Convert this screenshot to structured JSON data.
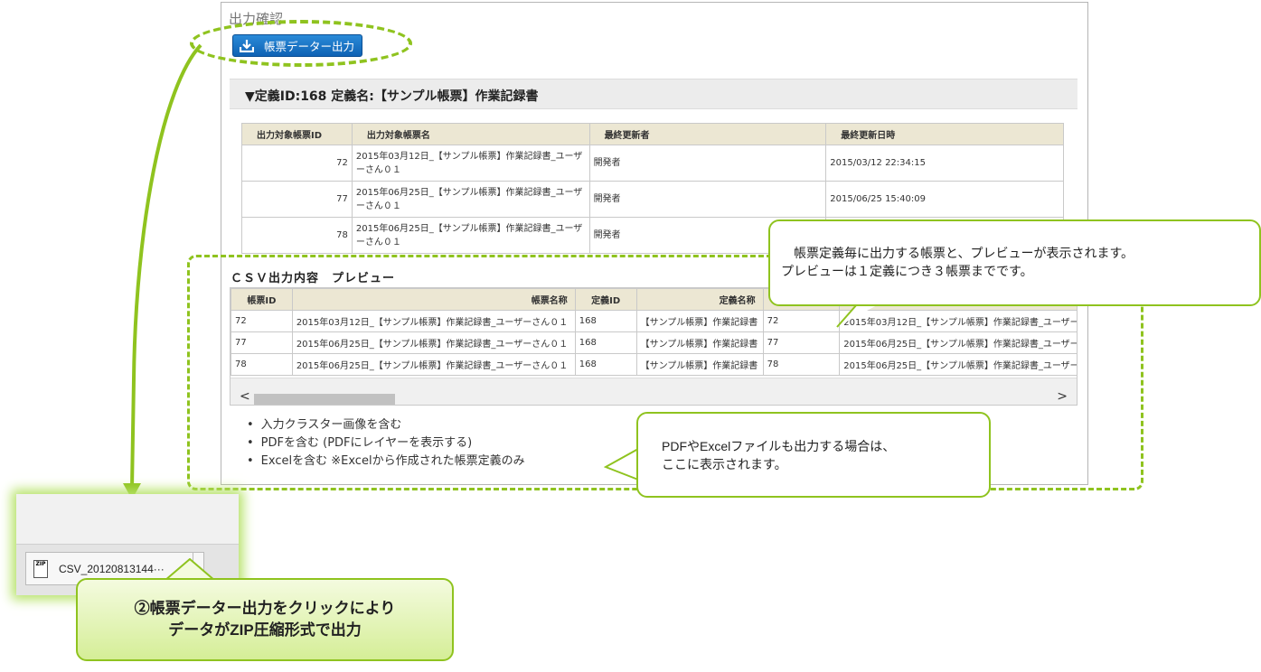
{
  "panel": {
    "title": "出力確認"
  },
  "export_button": {
    "label": "帳票データー出力",
    "icon": "download-icon"
  },
  "definition": {
    "header": "▼定義ID:168 定義名:【サンプル帳票】作業記録書"
  },
  "target_table": {
    "headers": [
      "出力対象帳票ID",
      "出力対象帳票名",
      "最終更新者",
      "最終更新日時"
    ],
    "rows": [
      {
        "id": "72",
        "name": "2015年03月12日_【サンプル帳票】作業記録書_ユーザーさん０１",
        "updater": "開発者",
        "updated": "2015/03/12 22:34:15"
      },
      {
        "id": "77",
        "name": "2015年06月25日_【サンプル帳票】作業記録書_ユーザーさん０１",
        "updater": "開発者",
        "updated": "2015/06/25 15:40:09"
      },
      {
        "id": "78",
        "name": "2015年06月25日_【サンプル帳票】作業記録書_ユーザーさん０１",
        "updater": "開発者",
        "updated": ""
      }
    ]
  },
  "csv_preview": {
    "title": "ＣＳＶ出力内容　プレビュー",
    "headers": [
      "帳票ID",
      "帳票名称",
      "定義ID",
      "定義名称",
      "",
      ""
    ],
    "rows": [
      [
        "72",
        "2015年03月12日_【サンプル帳票】作業記録書_ユーザーさん０１",
        "168",
        "【サンプル帳票】作業記録書",
        "72",
        "2015年03月12日_【サンプル帳票】作業記録書_ユーザー"
      ],
      [
        "77",
        "2015年06月25日_【サンプル帳票】作業記録書_ユーザーさん０１",
        "168",
        "【サンプル帳票】作業記録書",
        "77",
        "2015年06月25日_【サンプル帳票】作業記録書_ユーザー"
      ],
      [
        "78",
        "2015年06月25日_【サンプル帳票】作業記録書_ユーザーさん０１",
        "168",
        "【サンプル帳票】作業記録書",
        "78",
        "2015年06月25日_【サンプル帳票】作業記録書_ユーザー"
      ]
    ]
  },
  "options": [
    "入力クラスター画像を含む",
    "PDFを含む (PDFにレイヤーを表示する)",
    "Excelを含む ※Excelから作成された帳票定義のみ"
  ],
  "annotations": {
    "bubble_preview": [
      "帳票定義毎に出力する帳票と、プレビューが表示されます。",
      "プレビューは１定義につき３帳票までです。"
    ],
    "bubble_files": [
      "PDFやExcelファイルも出力する場合は、",
      "ここに表示されます。"
    ],
    "callout": [
      "②帳票データー出力をクリックにより",
      "データがZIP圧縮形式で出力"
    ]
  },
  "download": {
    "filename": "CSV_20120813144···",
    "icon": "zip-file-icon"
  },
  "colors": {
    "accent_green": "#8fc31f",
    "button_blue": "#1a74c6",
    "table_header": "#ece7d3"
  }
}
